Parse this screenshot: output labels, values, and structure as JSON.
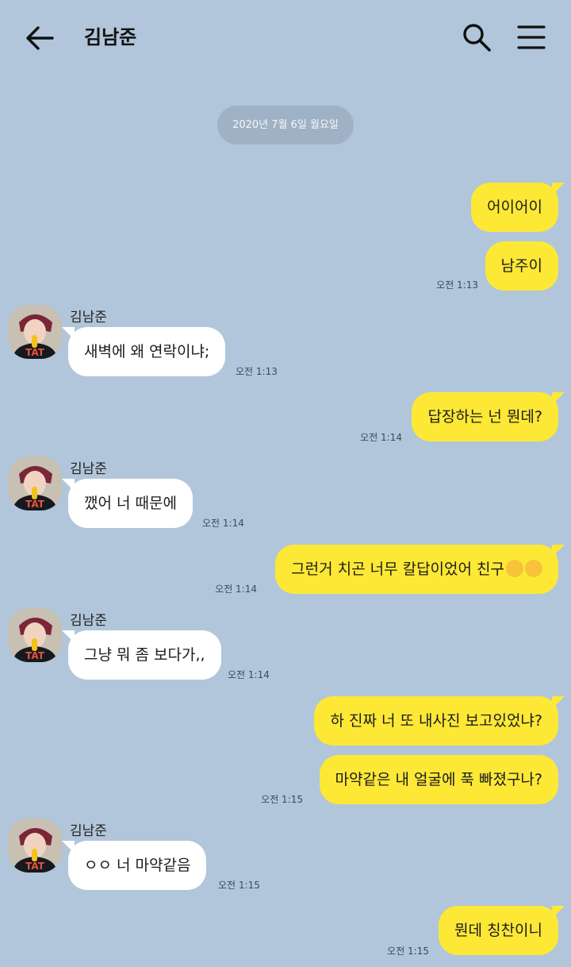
{
  "header": {
    "title": "김남준"
  },
  "date_divider": "2020년 7월 6일 월요일",
  "contact_name": "김남준",
  "messages": {
    "m1": {
      "text": "어이어이"
    },
    "m2": {
      "text": "남주이",
      "time": "오전 1:13"
    },
    "m3": {
      "text": "새벽에 왜 연락이냐;",
      "time": "오전 1:13"
    },
    "m4": {
      "text": "답장하는 넌 뭔데?",
      "time": "오전 1:14"
    },
    "m5": {
      "text": "깼어 너 때문에",
      "time": "오전 1:14"
    },
    "m6": {
      "text": "그런거 치곤 너무 칼답이었어 친구",
      "time": "오전 1:14"
    },
    "m7": {
      "text": "그냥 뭐 좀 보다가,,",
      "time": "오전 1:14"
    },
    "m8": {
      "text": "하 진짜 너 또 내사진 보고있었냐?"
    },
    "m9": {
      "text": "마약같은 내 얼굴에 푹 빠졌구나?",
      "time": "오전 1:15"
    },
    "m10": {
      "text": "ㅇㅇ 너 마약같음",
      "time": "오전 1:15"
    },
    "m11": {
      "text": "뭔데 칭찬이니",
      "time": "오전 1:15"
    }
  },
  "icons": {
    "back": "arrow-left-icon",
    "search": "search-icon",
    "menu": "hamburger-menu-icon",
    "emoji": "smirk-emoji-icon"
  },
  "colors": {
    "background": "#b1c6da",
    "my_bubble": "#fde836",
    "their_bubble": "#ffffff",
    "date_pill": "#9fb2c5"
  }
}
